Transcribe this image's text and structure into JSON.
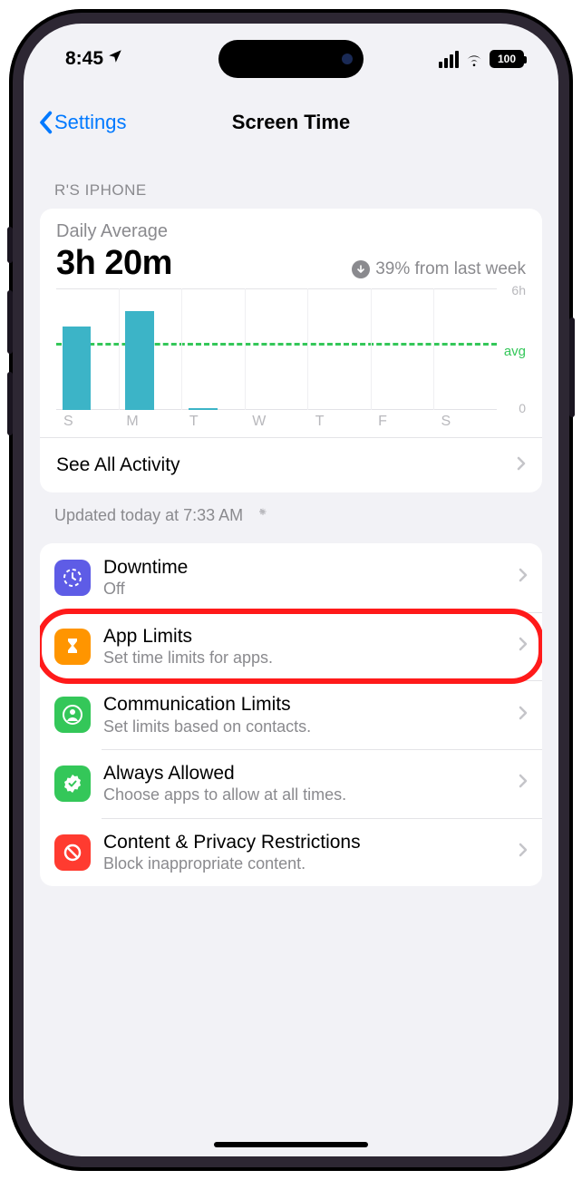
{
  "status": {
    "time": "8:45",
    "battery": "100"
  },
  "nav": {
    "back_label": "Settings",
    "title": "Screen Time"
  },
  "section_header": "R'S IPHONE",
  "summary": {
    "label": "Daily Average",
    "value": "3h 20m",
    "trend": "39% from last week"
  },
  "chart_data": {
    "type": "bar",
    "categories": [
      "S",
      "M",
      "T",
      "W",
      "T",
      "F",
      "S"
    ],
    "values": [
      4.1,
      4.9,
      0.1,
      0,
      0,
      0,
      0
    ],
    "avg": 3.33,
    "ylabel_top": "6h",
    "ylabel_bot": "0",
    "avg_label": "avg",
    "ylim": [
      0,
      6
    ]
  },
  "see_all": "See All Activity",
  "updated": "Updated today at 7:33 AM",
  "items": [
    {
      "title": "Downtime",
      "sub": "Off",
      "color": "#5e5ce6",
      "icon": "clock"
    },
    {
      "title": "App Limits",
      "sub": "Set time limits for apps.",
      "color": "#ff9500",
      "icon": "hourglass",
      "highlight": true
    },
    {
      "title": "Communication Limits",
      "sub": "Set limits based on contacts.",
      "color": "#34c759",
      "icon": "person"
    },
    {
      "title": "Always Allowed",
      "sub": "Choose apps to allow at all times.",
      "color": "#34c759",
      "icon": "check"
    },
    {
      "title": "Content & Privacy Restrictions",
      "sub": "Block inappropriate content.",
      "color": "#ff3b30",
      "icon": "nosign"
    }
  ]
}
